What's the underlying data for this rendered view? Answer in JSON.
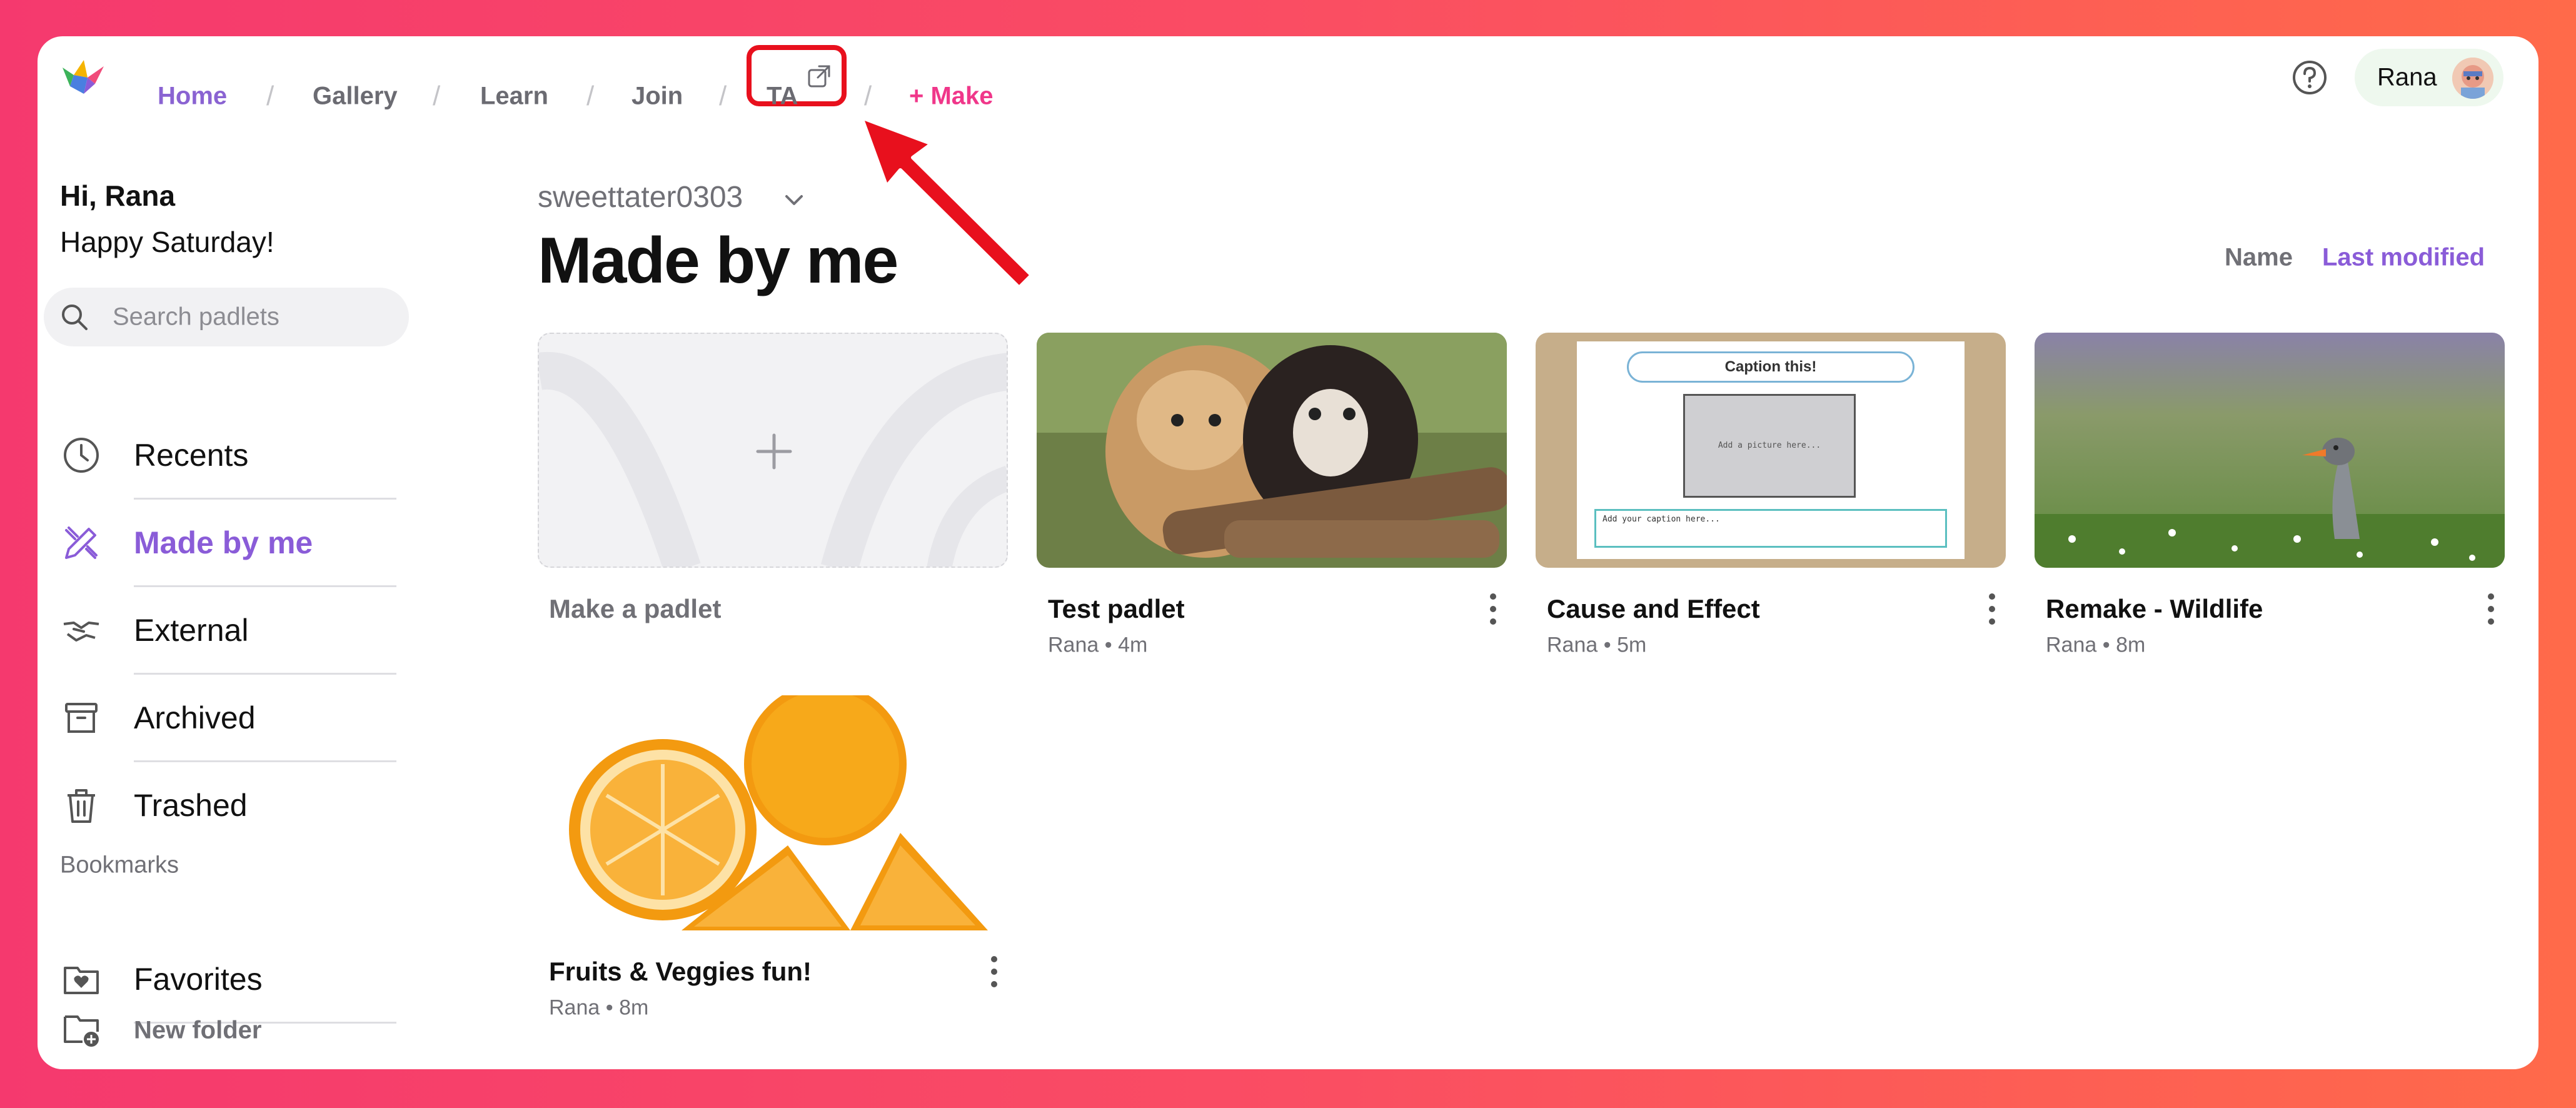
{
  "nav": {
    "home": "Home",
    "gallery": "Gallery",
    "learn": "Learn",
    "join": "Join",
    "ta": "TA",
    "make": "+ Make",
    "separator": "/",
    "user_name": "Rana"
  },
  "sidebar": {
    "greeting": "Hi, Rana",
    "subgreeting": "Happy Saturday!",
    "search_placeholder": "Search padlets",
    "items": [
      {
        "label": "Recents",
        "icon": "clock-icon"
      },
      {
        "label": "Made by me",
        "icon": "pencil-ruler-icon",
        "active": true
      },
      {
        "label": "External",
        "icon": "handshake-icon"
      },
      {
        "label": "Archived",
        "icon": "archive-box-icon"
      },
      {
        "label": "Trashed",
        "icon": "trash-icon"
      }
    ],
    "bookmarks_heading": "Bookmarks",
    "favorites": "Favorites",
    "new_folder": "New folder"
  },
  "main": {
    "account": "sweettater0303",
    "title": "Made by me",
    "sort_name": "Name",
    "sort_modified": "Last modified",
    "make_padlet": "Make a padlet",
    "cards": [
      {
        "title": "Test padlet",
        "author": "Rana",
        "time": "4m",
        "thumb": "puppies-photo"
      },
      {
        "title": "Cause and Effect",
        "author": "Rana",
        "time": "5m",
        "thumb": "caption-worksheet"
      },
      {
        "title": "Remake - Wildlife",
        "author": "Rana",
        "time": "8m",
        "thumb": "goose-photo"
      },
      {
        "title": "Fruits & Veggies fun!",
        "author": "Rana",
        "time": "8m",
        "thumb": "oranges-photo"
      }
    ],
    "caption_sheet": {
      "header": "Caption this!",
      "picture": "Add a picture here...",
      "caption": "Add your caption here..."
    }
  },
  "colors": {
    "accent_purple": "#8a5cd8",
    "make_pink": "#f0378a",
    "highlight_red": "#e8101d"
  }
}
